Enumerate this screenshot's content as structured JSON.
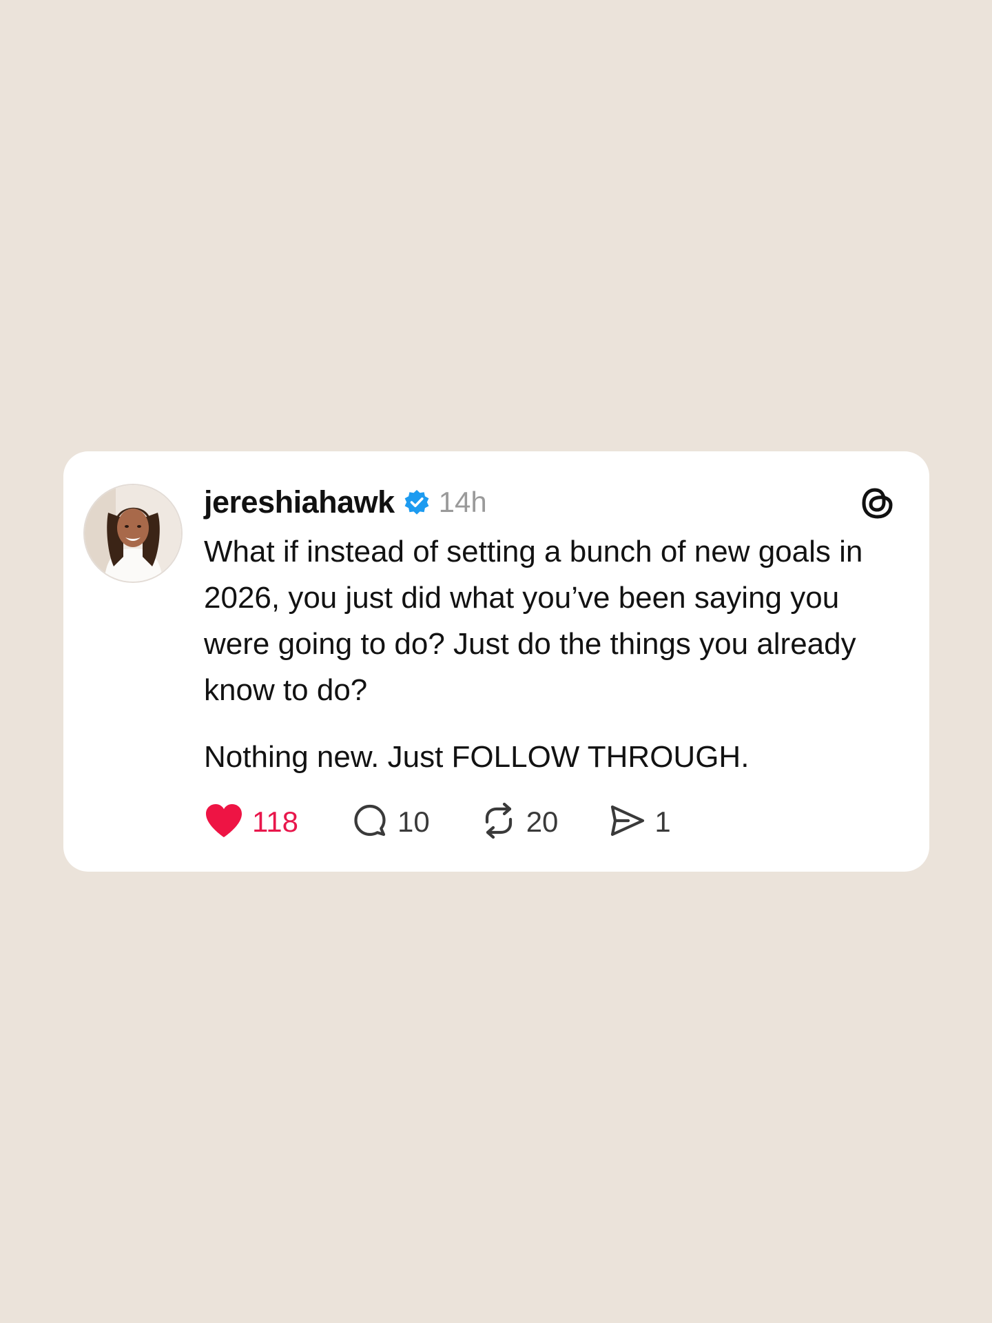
{
  "post": {
    "username": "jereshiahawk",
    "time": "14h",
    "paragraphs": [
      "What if instead of setting a bunch of new goals in 2026, you just did what you’ve been saying you were going to do? Just do the things you already know to do?",
      "Nothing new. Just FOLLOW THROUGH."
    ],
    "stats": {
      "likes": "118",
      "replies": "10",
      "reposts": "20",
      "shares": "1"
    }
  },
  "icons": {
    "avatar": "profile-photo",
    "verified": "verified-badge-icon",
    "brand": "threads-logo-icon",
    "like": "heart-icon",
    "reply": "comment-icon",
    "repost": "repost-icon",
    "share": "send-icon"
  },
  "colors": {
    "background": "#ebe3da",
    "card": "#ffffff",
    "verified": "#1d9bf0",
    "like": "#e8164b",
    "text": "#121212",
    "muted": "#9a9a9a"
  }
}
